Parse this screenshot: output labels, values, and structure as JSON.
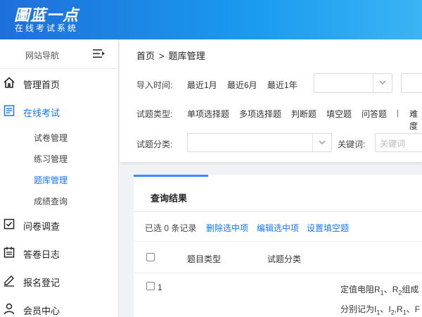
{
  "header": {
    "logo_title": "圖蓝一点",
    "logo_subtitle": "在线考试系统"
  },
  "sidebar": {
    "nav_title": "网站导航",
    "items": [
      {
        "label": "管理首页",
        "icon": "home-icon"
      },
      {
        "label": "在线考试",
        "icon": "exam-icon",
        "active": true
      },
      {
        "label": "问卷调查",
        "icon": "survey-icon"
      },
      {
        "label": "答卷日志",
        "icon": "log-icon"
      },
      {
        "label": "报名登记",
        "icon": "register-icon"
      },
      {
        "label": "会员中心",
        "icon": "user-icon"
      }
    ],
    "sub_items": [
      {
        "label": "试卷管理"
      },
      {
        "label": "练习管理"
      },
      {
        "label": "题库管理",
        "active": true
      },
      {
        "label": "成绩查询"
      }
    ]
  },
  "breadcrumb": {
    "home": "首页",
    "separator": ">",
    "current": "题库管理"
  },
  "filters": {
    "import_time_label": "导入时间:",
    "import_time_options": [
      "最近1月",
      "最近6月",
      "最近1年"
    ],
    "type_label": "试题类型:",
    "type_options": [
      "单项选择题",
      "多项选择题",
      "判断题",
      "填空题",
      "问答题"
    ],
    "type_divider": "|",
    "difficulty_label": "难度",
    "category_label": "试题分类:",
    "keyword_label": "关键词:",
    "keyword_placeholder": "关键词"
  },
  "results": {
    "tab_label": "查询结果",
    "selected_prefix": "已选",
    "selected_count": "0",
    "selected_suffix": "条记录",
    "actions": [
      "删除选中项",
      "编辑选中项",
      "设置填空题"
    ],
    "columns": [
      "题目类型",
      "试题分类"
    ],
    "rows": [
      {
        "index": "1",
        "text_line1": "定值电阻R1、R2组成",
        "text_line2": "分别记为I1、I2,R1、F"
      }
    ]
  },
  "colors": {
    "accent": "#1677ff",
    "header_start": "#1e6fd9",
    "header_end": "#3bb4f5",
    "tab_indicator": "#3d8cf5"
  }
}
